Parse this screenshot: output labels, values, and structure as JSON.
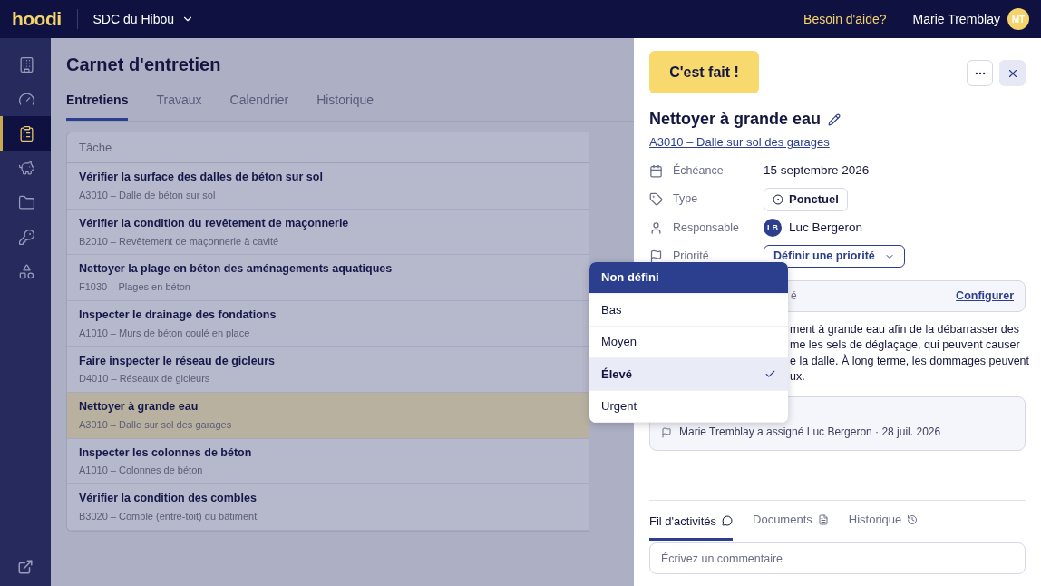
{
  "topbar": {
    "logo": "hoodi",
    "org": "SDC du Hibou",
    "help": "Besoin d'aide?",
    "user": "Marie Tremblay",
    "avatar": "MT"
  },
  "sidebar": {
    "items": [
      {
        "selected": false
      },
      {
        "selected": false
      },
      {
        "selected": true
      },
      {
        "selected": false
      },
      {
        "selected": false
      },
      {
        "selected": false
      },
      {
        "selected": false
      }
    ]
  },
  "page": {
    "title": "Carnet d'entretien",
    "tabs": [
      {
        "label": "Entretiens",
        "selected": true
      },
      {
        "label": "Travaux",
        "selected": false
      },
      {
        "label": "Calendrier",
        "selected": false
      },
      {
        "label": "Historique",
        "selected": false
      }
    ]
  },
  "table": {
    "columns": [
      "Tâche"
    ],
    "rows": [
      {
        "title": "Vérifier la surface des dalles de béton sur sol",
        "subtitle": "A3010 – Dalle de béton sur sol",
        "selected": false
      },
      {
        "title": "Vérifier la condition du revêtement de maçonnerie",
        "subtitle": "B2010 – Revêtement de maçonnerie à cavité",
        "selected": false
      },
      {
        "title": "Nettoyer la plage en béton des aménagements aquatiques",
        "subtitle": "F1030 – Plages en béton",
        "selected": false
      },
      {
        "title": "Inspecter le drainage des fondations",
        "subtitle": "A1010 – Murs de béton coulé en place",
        "selected": false
      },
      {
        "title": "Faire inspecter le réseau de gicleurs",
        "subtitle": "D4010 – Réseaux de gicleurs",
        "selected": false
      },
      {
        "title": "Nettoyer à grande eau",
        "subtitle": "A3010 – Dalle sur sol des garages",
        "selected": true
      },
      {
        "title": "Inspecter les colonnes de béton",
        "subtitle": "A1010 – Colonnes de béton",
        "selected": false
      },
      {
        "title": "Vérifier la condition des combles",
        "subtitle": "B3020 – Comble (entre-toit) du bâtiment",
        "selected": false
      }
    ]
  },
  "panel": {
    "done_button": "C'est fait !",
    "title": "Nettoyer à grande eau",
    "component_link": "A3010 – Dalle sur sol des garages",
    "fields": [
      {
        "kind": "text",
        "label": "Échéance",
        "value": "15 septembre 2026"
      },
      {
        "kind": "chip",
        "label": "Type",
        "value": "Ponctuel"
      },
      {
        "kind": "person",
        "label": "Responsable",
        "value": "Luc Bergeron",
        "initials": "LB"
      },
      {
        "kind": "select",
        "label": "Priorité",
        "value": "Définir une priorité"
      }
    ],
    "notice": {
      "text": "é",
      "link": "Configurer"
    },
    "description": [
      "ment à grande eau afin de la débarrasser des",
      "me les sels de déglaçage, qui peuvent causer",
      "e la dalle. À long terme, les dommages peuvent",
      "ux."
    ],
    "activity": "Marie Tremblay a assigné Luc Bergeron · 28 juil. 2026",
    "tabs": [
      {
        "label": "Fil d'activités",
        "selected": true
      },
      {
        "label": "Documents",
        "selected": false
      },
      {
        "label": "Historique",
        "selected": false
      }
    ],
    "comment": {
      "placeholder": "Écrivez un commentaire"
    }
  },
  "priority_menu": {
    "items": [
      {
        "label": "Non défini",
        "highlighted": true,
        "selected": false
      },
      {
        "label": "Bas",
        "highlighted": false,
        "selected": false
      },
      {
        "label": "Moyen",
        "highlighted": false,
        "selected": false
      },
      {
        "label": "Élevé",
        "highlighted": false,
        "selected": true
      },
      {
        "label": "Urgent",
        "highlighted": false,
        "selected": false
      }
    ]
  }
}
